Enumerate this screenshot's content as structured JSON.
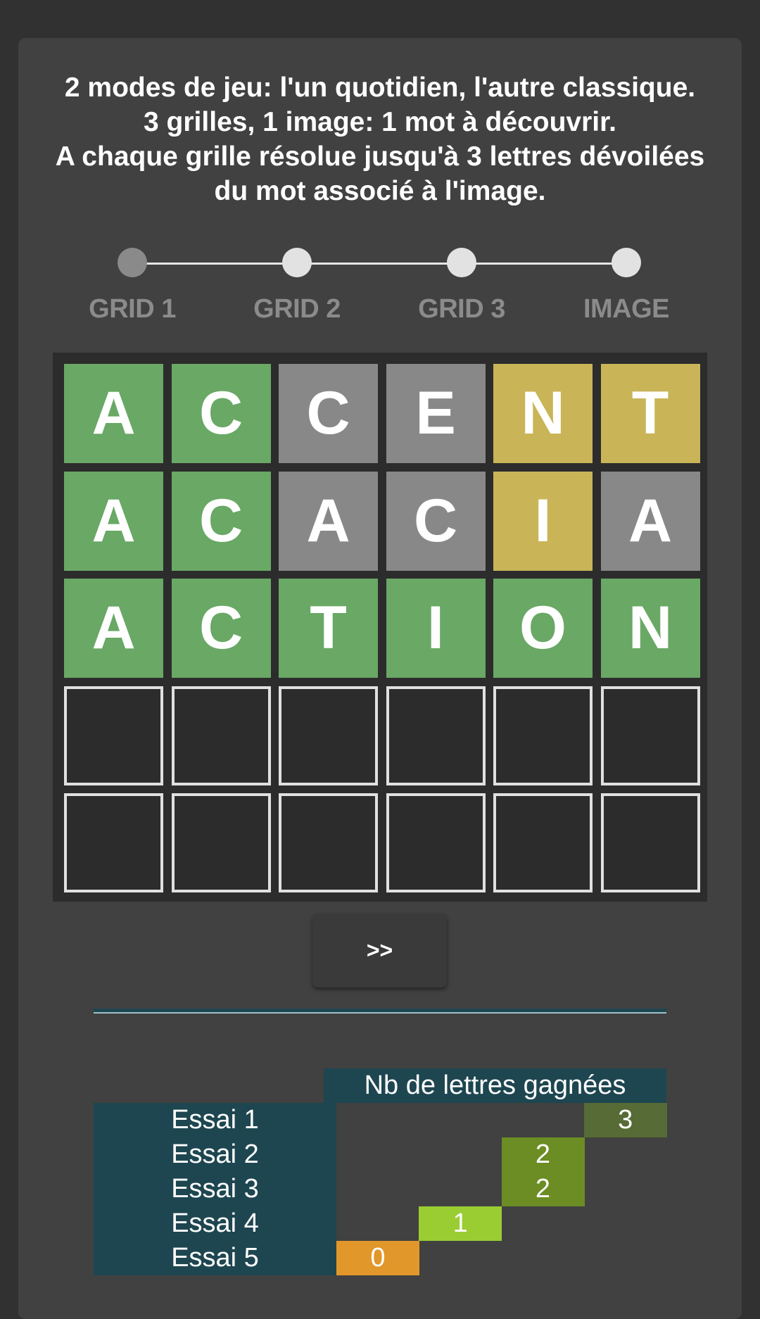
{
  "intro": {
    "lines": [
      "2 modes de jeu: l'un quotidien, l'autre classique.",
      "3 grilles, 1 image: 1 mot à découvrir.",
      "A chaque grille résolue jusqu'à 3 lettres dévoilées",
      "du mot associé à l'image."
    ]
  },
  "stepper": {
    "steps": [
      {
        "label": "GRID 1",
        "active": true
      },
      {
        "label": "GRID 2",
        "active": false
      },
      {
        "label": "GRID 3",
        "active": false
      },
      {
        "label": "IMAGE",
        "active": false
      }
    ]
  },
  "grid": {
    "rows": [
      [
        {
          "letter": "A",
          "state": "green"
        },
        {
          "letter": "C",
          "state": "green"
        },
        {
          "letter": "C",
          "state": "gray"
        },
        {
          "letter": "E",
          "state": "gray"
        },
        {
          "letter": "N",
          "state": "yellow"
        },
        {
          "letter": "T",
          "state": "yellow"
        }
      ],
      [
        {
          "letter": "A",
          "state": "green"
        },
        {
          "letter": "C",
          "state": "green"
        },
        {
          "letter": "A",
          "state": "gray"
        },
        {
          "letter": "C",
          "state": "gray"
        },
        {
          "letter": "I",
          "state": "yellow"
        },
        {
          "letter": "A",
          "state": "gray"
        }
      ],
      [
        {
          "letter": "A",
          "state": "green"
        },
        {
          "letter": "C",
          "state": "green"
        },
        {
          "letter": "T",
          "state": "green"
        },
        {
          "letter": "I",
          "state": "green"
        },
        {
          "letter": "O",
          "state": "green"
        },
        {
          "letter": "N",
          "state": "green"
        }
      ],
      [
        {
          "letter": "",
          "state": "empty"
        },
        {
          "letter": "",
          "state": "empty"
        },
        {
          "letter": "",
          "state": "empty"
        },
        {
          "letter": "",
          "state": "empty"
        },
        {
          "letter": "",
          "state": "empty"
        },
        {
          "letter": "",
          "state": "empty"
        }
      ],
      [
        {
          "letter": "",
          "state": "empty"
        },
        {
          "letter": "",
          "state": "empty"
        },
        {
          "letter": "",
          "state": "empty"
        },
        {
          "letter": "",
          "state": "empty"
        },
        {
          "letter": "",
          "state": "empty"
        },
        {
          "letter": "",
          "state": "empty"
        }
      ]
    ]
  },
  "next_button": {
    "label": ">>"
  },
  "stats": {
    "header": "Nb de lettres gagnées",
    "rows": [
      {
        "label": "Essai 1",
        "value": "3",
        "color": "#566b35"
      },
      {
        "label": "Essai 2",
        "value": "2",
        "color": "#6c8d24"
      },
      {
        "label": "Essai 3",
        "value": "2",
        "color": "#6c8d24"
      },
      {
        "label": "Essai 4",
        "value": "1",
        "color": "#9acd32"
      },
      {
        "label": "Essai 5",
        "value": "0",
        "color": "#e2972a"
      }
    ]
  },
  "colors": {
    "green": "#69a865",
    "gray": "#888888",
    "yellow": "#c9b458",
    "teal": "#1e4650"
  }
}
